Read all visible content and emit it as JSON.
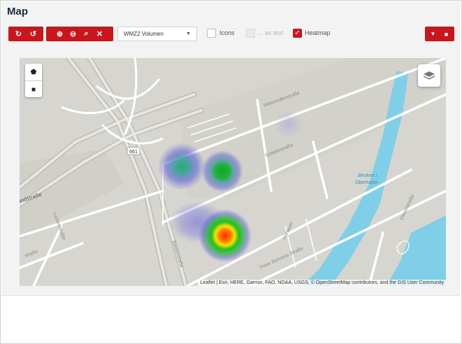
{
  "page": {
    "title": "Map"
  },
  "toolbar": {
    "buttons_left": [
      {
        "name": "refresh-icon",
        "glyph": "↻"
      },
      {
        "name": "undo-icon",
        "glyph": "↺"
      },
      {
        "name": "zoom-in-icon",
        "glyph": "⊕"
      },
      {
        "name": "zoom-out-icon",
        "glyph": "⊖"
      },
      {
        "name": "search-icon",
        "glyph": "⌕"
      },
      {
        "name": "fullscreen-icon",
        "glyph": "✕"
      }
    ],
    "layer_select": {
      "value": "WMZ2 Volumen"
    },
    "icons_label": "Icons",
    "as_text_label": "... as text",
    "heatmap_label": "Heatmap",
    "heatmap_checked": true,
    "icons_checked": false,
    "as_text_disabled": true,
    "buttons_right": [
      {
        "name": "filter-icon",
        "glyph": "▼"
      },
      {
        "name": "delete-icon",
        "glyph": "🗑"
      }
    ],
    "accent_color": "#c9161d"
  },
  "map": {
    "street_labels": {
      "weismuller": "Weismüllerstraße",
      "schiele": "Schielestraße",
      "peter_behrens": "Peter Behrens Straße",
      "bieder": "Biederstraße",
      "landstrasse": "andstraße",
      "ruckert": "ruckertstraße",
      "staße": "straße",
      "hanauer": "Hanauer",
      "dieselstrasse": "Dieselstraße",
      "becken": "Becken I",
      "oberhafen": "Oberhafen",
      "route_shield": "661"
    },
    "controls": {
      "marker_icon": "pentagon-icon",
      "rect_icon": "square-icon",
      "layers_icon": "layers-icon"
    },
    "attribution": "Leaflet | Esri, HERE, Garmin, FAO, NOAA, USGS, © OpenStreetMap contributors, and the GIS User Community",
    "heat_points": [
      {
        "id": "hot",
        "level": "high"
      },
      {
        "id": "mid",
        "level": "medium"
      },
      {
        "id": "left",
        "level": "low"
      },
      {
        "id": "faint",
        "level": "very-low"
      }
    ],
    "water_color": "#7fcfe8"
  }
}
